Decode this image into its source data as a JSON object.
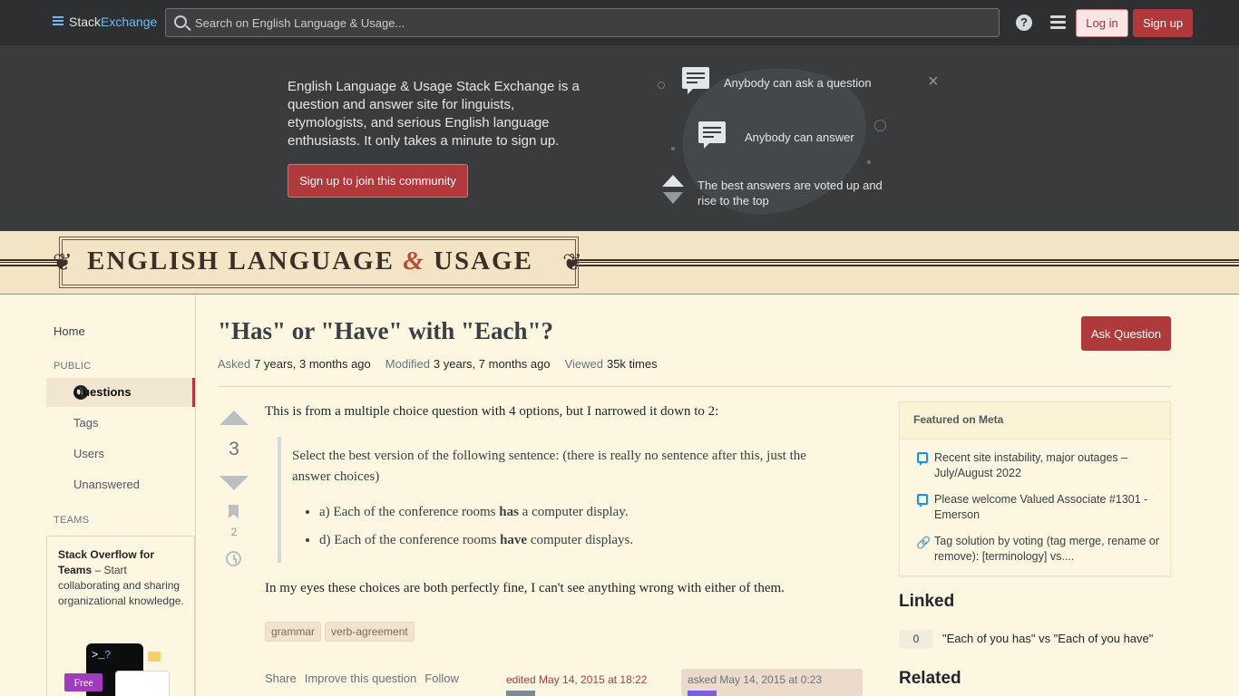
{
  "topbar": {
    "logo_stack": "Stack",
    "logo_exchange": "Exchange",
    "search_placeholder": "Search on English Language & Usage...",
    "help_icon": "?",
    "login_label": "Log in",
    "signup_label": "Sign up"
  },
  "hero": {
    "text": "English Language & Usage Stack Exchange is a question and answer site for linguists, etymologists, and serious English language enthusiasts. It only takes a minute to sign up.",
    "cta_label": "Sign up to join this community",
    "features": [
      "Anybody can ask a question",
      "Anybody can answer",
      "The best answers are voted up and rise to the top"
    ],
    "close_icon": "×"
  },
  "site_header": {
    "title_left": "ENGLISH LANGUAGE",
    "title_amp": "&",
    "title_right": "USAGE"
  },
  "nav": {
    "home": "Home",
    "public_label": "PUBLIC",
    "questions": "Questions",
    "tags": "Tags",
    "users": "Users",
    "unanswered": "Unanswered",
    "teams_label": "TEAMS",
    "teams_title": "Stack Overflow for Teams",
    "teams_desc": " – Start collaborating and sharing organizational knowledge.",
    "teams_prompt": ">_",
    "teams_q": "?",
    "teams_free": "Free"
  },
  "question": {
    "title": "\"Has\" or \"Have\" with \"Each\"?",
    "ask_button": "Ask Question",
    "asked_label": "Asked",
    "asked_value": "7 years, 3 months ago",
    "modified_label": "Modified",
    "modified_value": "3 years, 7 months ago",
    "viewed_label": "Viewed",
    "viewed_value": "35k times",
    "votes": "3",
    "bookmarks": "2",
    "body_intro": "This is from a multiple choice question with 4 options, but I narrowed it down to 2:",
    "quote_text": "Select the best version of the following sentence: (there is really no sentence after this, just the answer choices)",
    "option_a_pre": "a) Each of the conference rooms ",
    "option_a_bold": "has",
    "option_a_post": " a computer display.",
    "option_d_pre": "d) Each of the conference rooms ",
    "option_d_bold": "have",
    "option_d_post": " computer displays.",
    "body_end": "In my eyes these choices are both perfectly fine, I can't see anything wrong with either of them.",
    "tags": [
      "grammar",
      "verb-agreement"
    ],
    "share": "Share",
    "improve": "Improve this question",
    "follow": "Follow",
    "edited": "edited May 14, 2015 at 18:22",
    "asked_card": "asked May 14, 2015 at 0:23"
  },
  "sidebar": {
    "featured_title": "Featured on Meta",
    "featured_items": [
      "Recent site instability, major outages – July/August 2022",
      "Please welcome Valued Associate #1301 - Emerson",
      "Tag solution by voting (tag merge, rename or remove): [terminology] vs...."
    ],
    "linked_title": "Linked",
    "linked_count": "0",
    "linked_item": "\"Each of you has\" vs \"Each of you have\"",
    "related_title": "Related"
  }
}
